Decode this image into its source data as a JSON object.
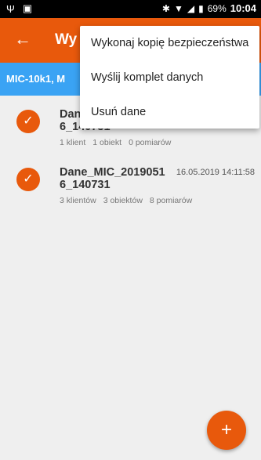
{
  "status_bar": {
    "usb_icon": "usb-icon",
    "screenshot_icon": "screenshot-icon",
    "bluetooth_icon": "bluetooth-icon",
    "battery": "69%",
    "time": "10:04"
  },
  "app_bar": {
    "title": "Wy",
    "accent": "#e8590c"
  },
  "device_bar": {
    "label": "MIC-10k1, M",
    "color": "#3aa3f4"
  },
  "items": [
    {
      "name": "Dane_MIC_2019051 6_140731",
      "date": "",
      "clients": "1 klient",
      "objects": "1 obiekt",
      "measurements": "0 pomiarów"
    },
    {
      "name": "Dane_MIC_2019051 6_140731",
      "date": "16.05.2019 14:11:58",
      "clients": "3 klientów",
      "objects": "3 obiektów",
      "measurements": "8 pomiarów"
    }
  ],
  "menu": {
    "items": [
      "Wykonaj kopię bezpieczeństwa",
      "Wyślij komplet danych",
      "Usuń dane"
    ]
  },
  "fab": {
    "icon": "plus-icon"
  }
}
